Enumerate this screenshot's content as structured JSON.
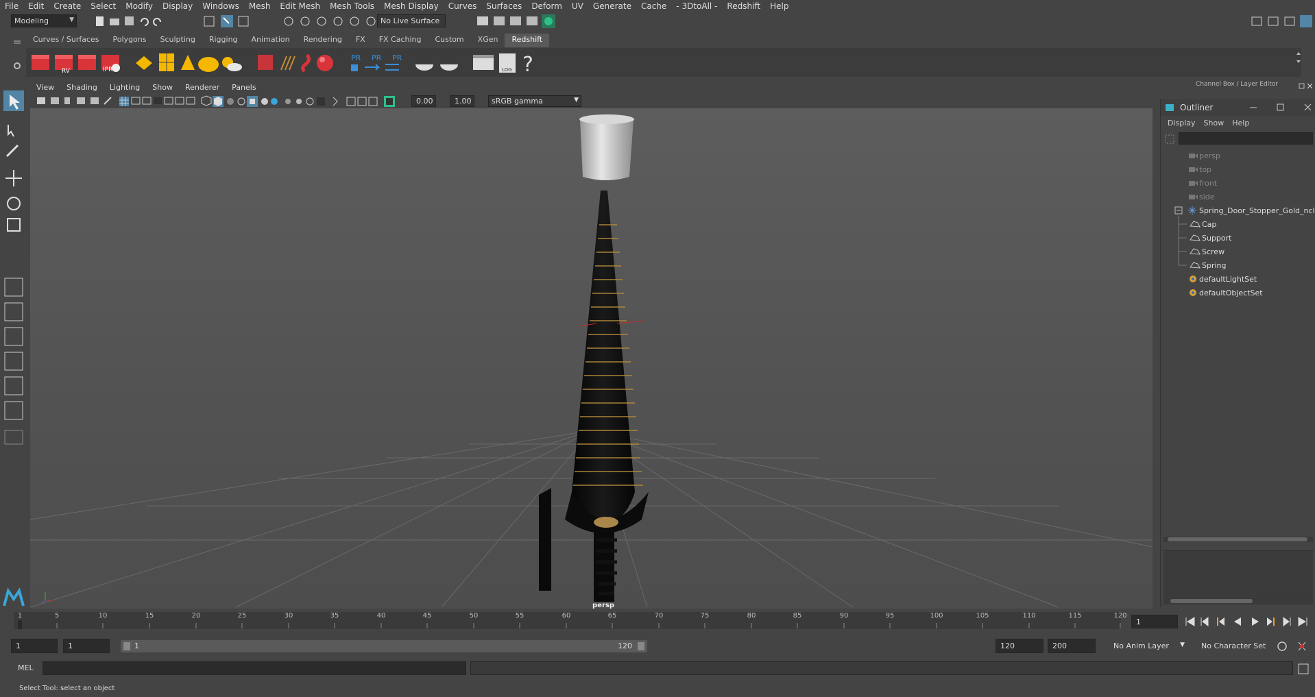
{
  "menu": {
    "items": [
      "File",
      "Edit",
      "Create",
      "Select",
      "Modify",
      "Display",
      "Windows",
      "Mesh",
      "Edit Mesh",
      "Mesh Tools",
      "Mesh Display",
      "Curves",
      "Surfaces",
      "Deform",
      "UV",
      "Generate",
      "Cache",
      "- 3DtoAll -",
      "Redshift",
      "Help"
    ]
  },
  "statusline": {
    "mode": "Modeling",
    "live_surface": "No Live Surface"
  },
  "shelf": {
    "tabs": [
      "Curves / Surfaces",
      "Polygons",
      "Sculpting",
      "Rigging",
      "Animation",
      "Rendering",
      "FX",
      "FX Caching",
      "Custom",
      "XGen",
      "Redshift"
    ],
    "active_tab": "Redshift",
    "icons": {
      "rv": "RV",
      "ipr": "IPR",
      "pr1": "PR",
      "pr2": "PR",
      "pr3": "PR",
      "log": "LOG",
      "help": "?"
    }
  },
  "viewport": {
    "menus": [
      "View",
      "Shading",
      "Lighting",
      "Show",
      "Renderer",
      "Panels"
    ],
    "exposure": "0.00",
    "gamma": "1.00",
    "colorspace": "sRGB gamma",
    "camera_label": "persp"
  },
  "right_panel": {
    "title": "Channel Box / Layer Editor"
  },
  "outliner": {
    "title": "Outliner",
    "menus": [
      "Display",
      "Show",
      "Help"
    ],
    "cameras": [
      "persp",
      "top",
      "front",
      "side"
    ],
    "group": "Spring_Door_Stopper_Gold_ncl",
    "children": [
      "Cap",
      "Support",
      "Screw",
      "Spring"
    ],
    "sets": [
      "defaultLightSet",
      "defaultObjectSet"
    ]
  },
  "timeline": {
    "ticks": [
      "1",
      "5",
      "10",
      "15",
      "20",
      "25",
      "30",
      "35",
      "40",
      "45",
      "50",
      "55",
      "60",
      "65",
      "70",
      "75",
      "80",
      "85",
      "90",
      "95",
      "100",
      "105",
      "110",
      "115",
      "120"
    ],
    "current_frame": "1"
  },
  "range": {
    "start": "1",
    "anim_start": "1",
    "slider_start": "1",
    "slider_end": "120",
    "anim_end": "120",
    "end": "200",
    "anim_layer": "No Anim Layer",
    "char_set": "No Character Set"
  },
  "command": {
    "lang": "MEL"
  },
  "helpline": {
    "text": "Select Tool: select an object"
  },
  "colors": {
    "accent": "#5285a6",
    "shelf_red": "#d9343a",
    "shelf_yellow": "#f5b800",
    "pr_blue": "#3a8fd8"
  }
}
